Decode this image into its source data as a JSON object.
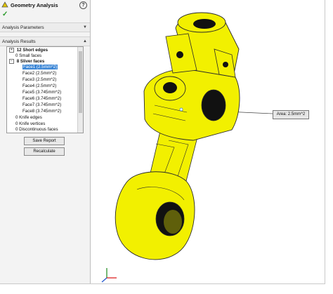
{
  "panel": {
    "title": "Geometry Analysis",
    "help_glyph": "?",
    "ok_glyph": "✓",
    "sections": {
      "parameters": "Analysis Parameters",
      "results": "Analysis Results"
    },
    "tree": {
      "items": [
        {
          "label": "12 Short edges",
          "bold": true,
          "expander": "+"
        },
        {
          "label": "0 Small faces",
          "bold": false
        },
        {
          "label": "8 Sliver faces",
          "bold": true,
          "expander": "−"
        },
        {
          "label": "Face1 (2.5mm^2)",
          "selected": true
        },
        {
          "label": "Face2 (2.5mm^2)"
        },
        {
          "label": "Face3 (2.5mm^2)"
        },
        {
          "label": "Face4 (2.5mm^2)"
        },
        {
          "label": "Face5 (3.745mm^2)"
        },
        {
          "label": "Face6 (3.745mm^2)"
        },
        {
          "label": "Face7 (3.745mm^2)"
        },
        {
          "label": "Face8 (3.745mm^2)"
        },
        {
          "label": "0 Knife edges"
        },
        {
          "label": "0 Knife vertices"
        },
        {
          "label": "0 Discontinuous faces"
        }
      ]
    },
    "buttons": {
      "save_report": "Save Report",
      "recalculate": "Recalculate"
    }
  },
  "viewport": {
    "callout_text": "Area: 2.5mm^2",
    "part_color": "#f2f000",
    "edge_color": "#2a2a2a"
  }
}
